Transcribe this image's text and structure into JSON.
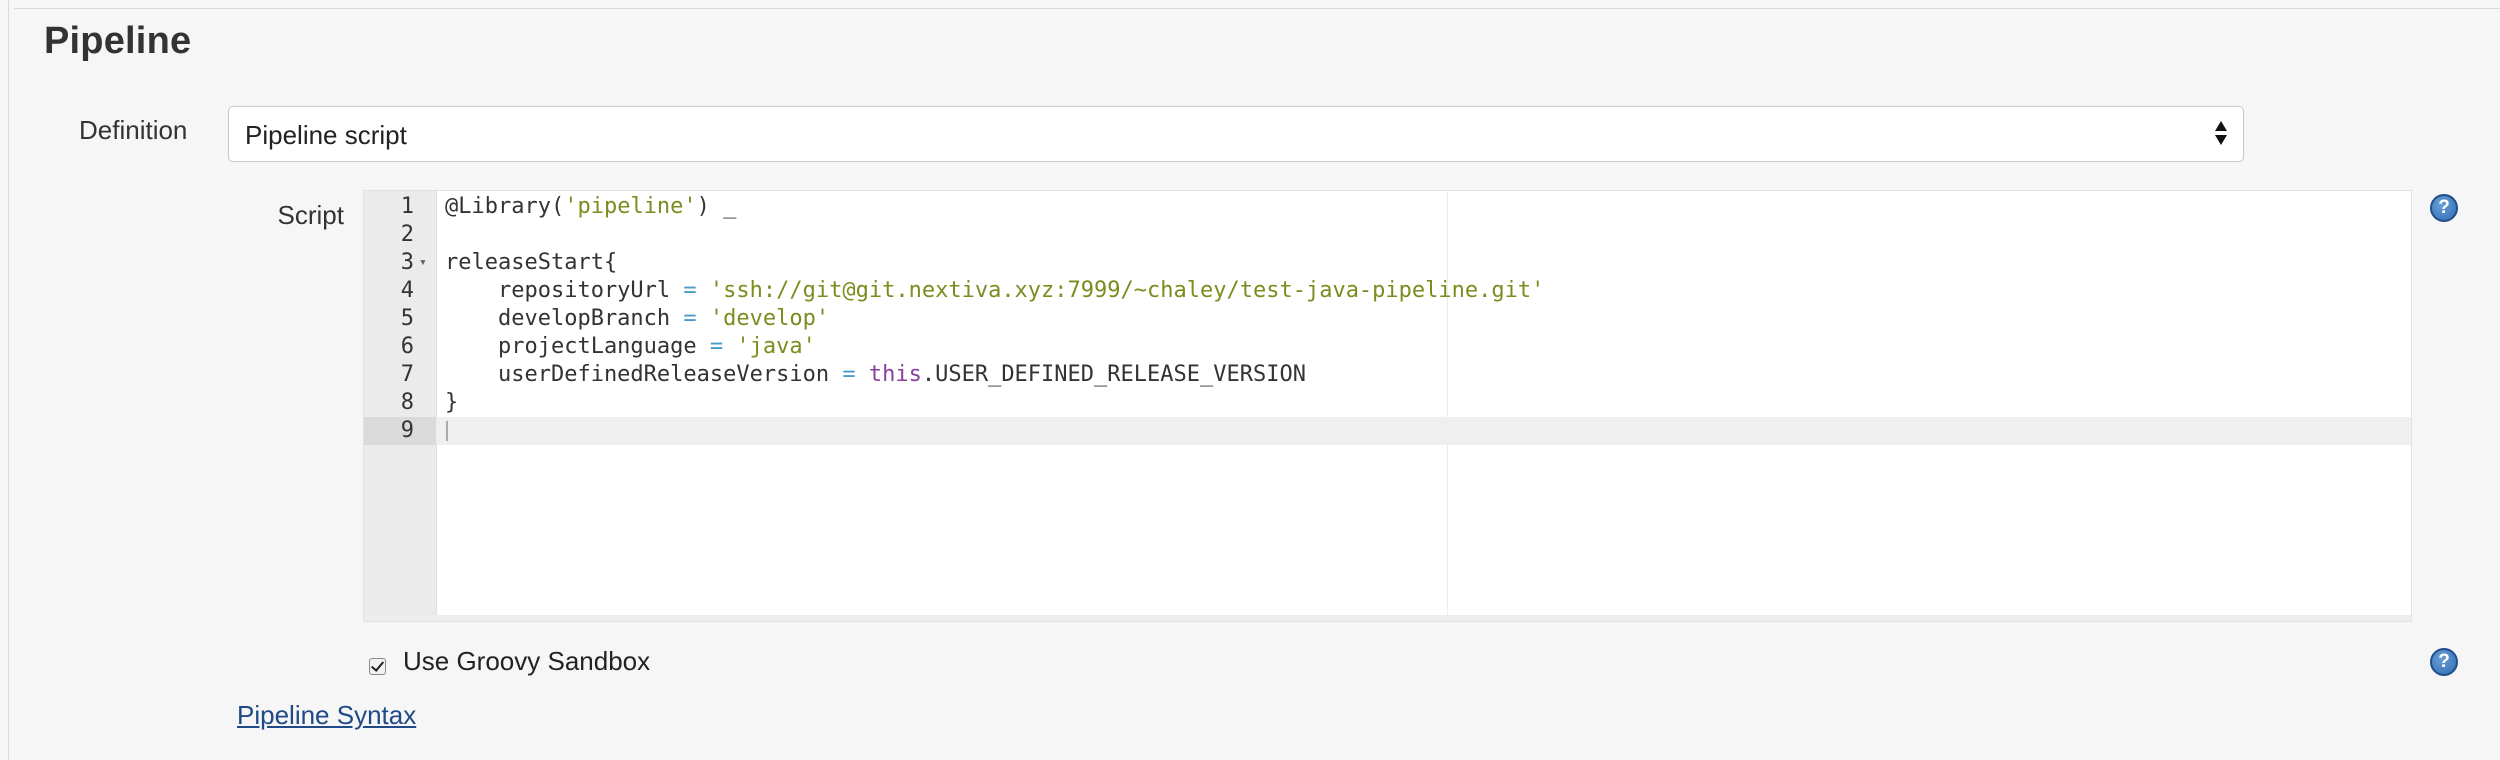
{
  "section": {
    "title": "Pipeline"
  },
  "definition": {
    "label": "Definition",
    "selected": "Pipeline script"
  },
  "script": {
    "label": "Script",
    "lines": [
      {
        "num": "1",
        "fold": "",
        "tokens": [
          {
            "t": "@Library(",
            "c": ""
          },
          {
            "t": "'pipeline'",
            "c": "str"
          },
          {
            "t": ") _",
            "c": ""
          }
        ]
      },
      {
        "num": "2",
        "fold": "",
        "tokens": []
      },
      {
        "num": "3",
        "fold": "▾",
        "tokens": [
          {
            "t": "releaseStart{",
            "c": ""
          }
        ]
      },
      {
        "num": "4",
        "fold": "",
        "tokens": [
          {
            "t": "    repositoryUrl ",
            "c": ""
          },
          {
            "t": "=",
            "c": "op"
          },
          {
            "t": " ",
            "c": ""
          },
          {
            "t": "'ssh://git@git.nextiva.xyz:7999/~chaley/test-java-pipeline.git'",
            "c": "str"
          }
        ]
      },
      {
        "num": "5",
        "fold": "",
        "tokens": [
          {
            "t": "    developBranch ",
            "c": ""
          },
          {
            "t": "=",
            "c": "op"
          },
          {
            "t": " ",
            "c": ""
          },
          {
            "t": "'develop'",
            "c": "str"
          }
        ]
      },
      {
        "num": "6",
        "fold": "",
        "tokens": [
          {
            "t": "    projectLanguage ",
            "c": ""
          },
          {
            "t": "=",
            "c": "op"
          },
          {
            "t": " ",
            "c": ""
          },
          {
            "t": "'java'",
            "c": "str"
          }
        ]
      },
      {
        "num": "7",
        "fold": "",
        "tokens": [
          {
            "t": "    userDefinedReleaseVersion ",
            "c": ""
          },
          {
            "t": "=",
            "c": "op"
          },
          {
            "t": " ",
            "c": ""
          },
          {
            "t": "this",
            "c": "kw"
          },
          {
            "t": ".USER_DEFINED_RELEASE_VERSION",
            "c": ""
          }
        ]
      },
      {
        "num": "8",
        "fold": "",
        "tokens": [
          {
            "t": "}",
            "c": ""
          }
        ]
      },
      {
        "num": "9",
        "fold": "",
        "tokens": [],
        "active": true
      }
    ]
  },
  "sandbox": {
    "label": "Use Groovy Sandbox",
    "checked": true
  },
  "links": {
    "pipeline_syntax": "Pipeline Syntax"
  },
  "icons": {
    "help": "help-icon",
    "help_glyph": "?"
  },
  "colors": {
    "string": "#7d8c1e",
    "operator": "#4a9ac9",
    "keyword": "#8a3f9e",
    "link": "#204a87",
    "help_icon": "#2f6bb0"
  }
}
